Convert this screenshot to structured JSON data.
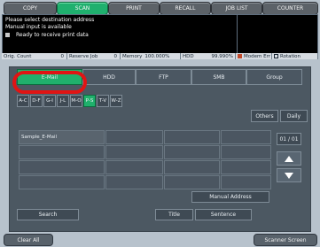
{
  "mode_tabs": [
    "COPY",
    "SCAN",
    "PRINT",
    "RECALL",
    "JOB LIST",
    "COUNTER"
  ],
  "message": {
    "line1": "Please select destination address",
    "line2": "Manual input is available",
    "line3": "Ready to receive print data"
  },
  "status": {
    "orig_count": "Orig. Count",
    "orig_count_value": "0",
    "reserve_job": "Reserve Job",
    "reserve_job_value": "0",
    "memory": "Memory",
    "memory_value": "100.000%",
    "hdd": "HDD",
    "hdd_value": "99.990%",
    "modem": "Modem Err",
    "rotation": "Rotation"
  },
  "categories": [
    "E-Mail",
    "HDD",
    "FTP",
    "SMB",
    "Group"
  ],
  "alpha_tabs": [
    "A-C",
    "D-F",
    "G-I",
    "J-L",
    "M-O",
    "P-S",
    "T-V",
    "W-Z"
  ],
  "actions": {
    "others": "Others",
    "daily": "Daily"
  },
  "addresses": [
    "Sample_E-Mail"
  ],
  "page": "01 / 01",
  "manual_address": "Manual Address",
  "search": "Search",
  "title": "Title",
  "sentence": "Sentence",
  "footer": {
    "clear_all": "Clear All",
    "scanner_screen": "Scanner Screen"
  }
}
